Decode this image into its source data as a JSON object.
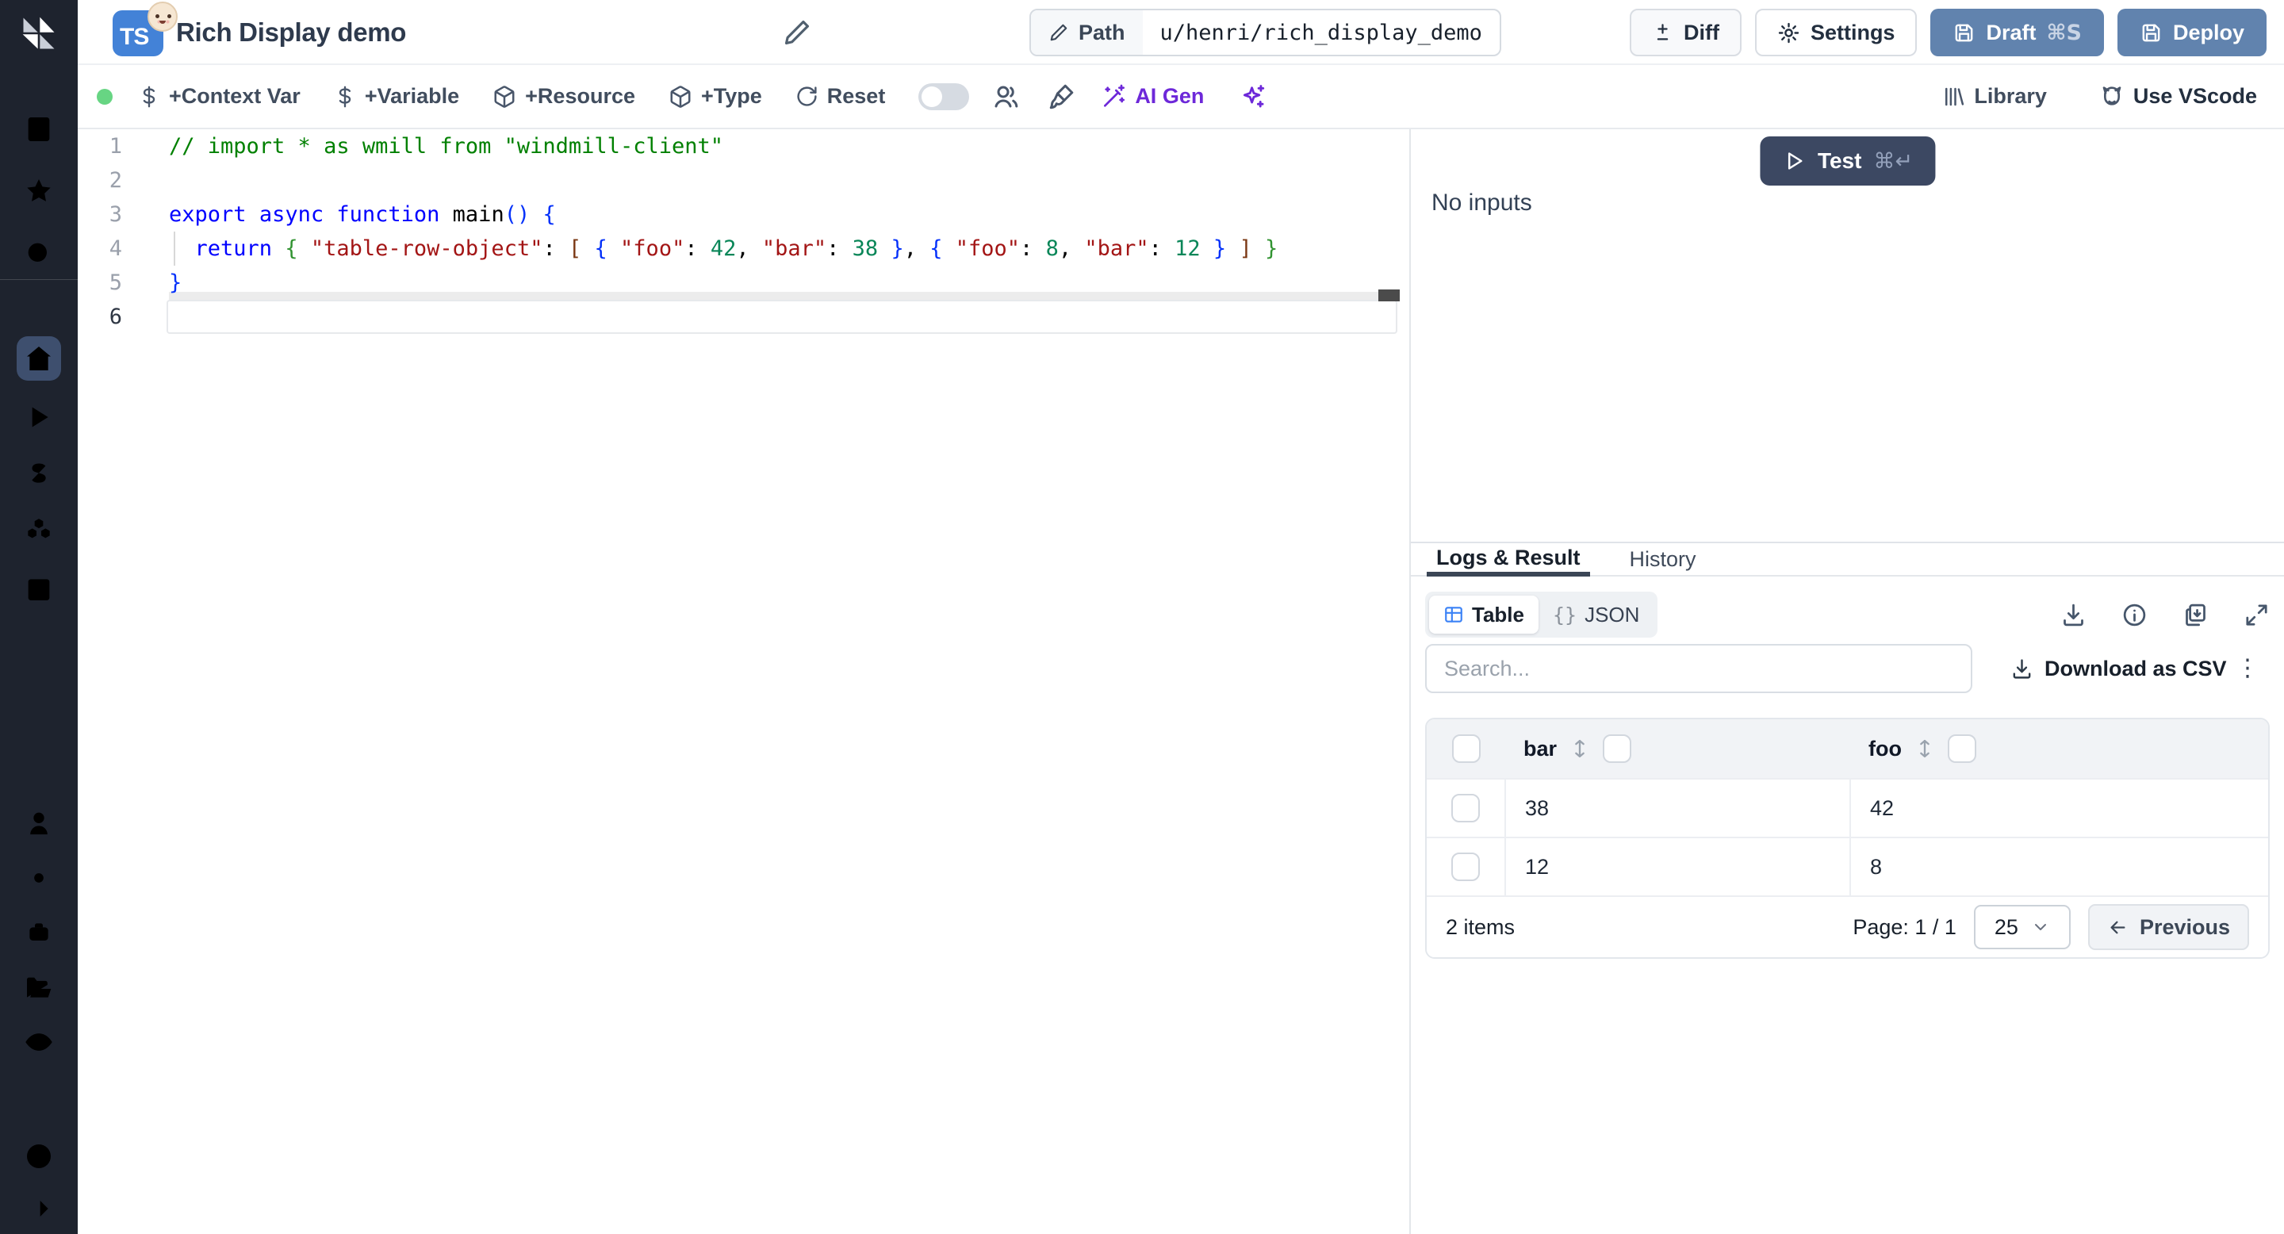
{
  "colors": {
    "sidebar_bg": "#1e232e",
    "sidebar_active": "#3e4f6e",
    "slate_button": "#6183ae",
    "test_button": "#3c4862",
    "accent_violet": "#6d28d9",
    "status_green": "#67d583",
    "ts_badge_blue": "#4382d7",
    "tab_underline": "#3b4656",
    "table_icon_blue": "#3b82f6",
    "syntax": {
      "comment": "#008000",
      "keyword": "#0000ff",
      "string": "#a31515",
      "number": "#098658",
      "bracket1": "#0431fa",
      "bracket2": "#319331",
      "bracket3": "#7b3814"
    }
  },
  "sidebar": {
    "logo": "windmill-logo",
    "top_items": [
      "buildings",
      "star",
      "search"
    ],
    "main_items": [
      "home",
      "runs-play",
      "variables-dollar",
      "resources-boxes",
      "schedules-calendar"
    ],
    "active_item": "home",
    "secondary_items": [
      "user",
      "settings-gear",
      "workers-bot",
      "folders",
      "audit-eye"
    ],
    "bottom_items": [
      "help",
      "expand-sidebar-arrow"
    ]
  },
  "header": {
    "lang_badge": "TS",
    "emoji_icon": "baby-face-emoji",
    "title": "Rich Display demo",
    "path_label": "Path",
    "path_value": "u/henri/rich_display_demo",
    "diff_label": "Diff",
    "settings_label": "Settings",
    "draft_label": "Draft",
    "draft_shortcut": "⌘S",
    "deploy_label": "Deploy"
  },
  "toolbar": {
    "context_var": "+Context Var",
    "variable": "+Variable",
    "resource": "+Resource",
    "type": "+Type",
    "reset": "Reset",
    "ai_gen": "AI Gen",
    "library": "Library",
    "vscode": "Use VScode"
  },
  "editor": {
    "language": "typescript",
    "active_line": 6,
    "lines": [
      {
        "tokens": [
          {
            "t": "// import * as wmill from \"windmill-client\"",
            "c": "comment"
          }
        ]
      },
      {
        "tokens": []
      },
      {
        "tokens": [
          {
            "t": "export",
            "c": "kw"
          },
          {
            "t": " ",
            "c": "pl"
          },
          {
            "t": "async",
            "c": "kw"
          },
          {
            "t": " ",
            "c": "pl"
          },
          {
            "t": "function",
            "c": "kw"
          },
          {
            "t": " ",
            "c": "pl"
          },
          {
            "t": "main",
            "c": "fn"
          },
          {
            "t": "(",
            "c": "b1"
          },
          {
            "t": ")",
            "c": "b1"
          },
          {
            "t": " ",
            "c": "pl"
          },
          {
            "t": "{",
            "c": "b1"
          }
        ]
      },
      {
        "tokens": [
          {
            "t": "  ",
            "c": "pl"
          },
          {
            "t": "return",
            "c": "kw"
          },
          {
            "t": " ",
            "c": "pl"
          },
          {
            "t": "{",
            "c": "b2"
          },
          {
            "t": " ",
            "c": "pl"
          },
          {
            "t": "\"table-row-object\"",
            "c": "str"
          },
          {
            "t": ": ",
            "c": "pl"
          },
          {
            "t": "[",
            "c": "b3"
          },
          {
            "t": " ",
            "c": "pl"
          },
          {
            "t": "{",
            "c": "b1"
          },
          {
            "t": " ",
            "c": "pl"
          },
          {
            "t": "\"foo\"",
            "c": "str"
          },
          {
            "t": ": ",
            "c": "pl"
          },
          {
            "t": "42",
            "c": "num"
          },
          {
            "t": ", ",
            "c": "pl"
          },
          {
            "t": "\"bar\"",
            "c": "str"
          },
          {
            "t": ": ",
            "c": "pl"
          },
          {
            "t": "38",
            "c": "num"
          },
          {
            "t": " ",
            "c": "pl"
          },
          {
            "t": "}",
            "c": "b1"
          },
          {
            "t": ", ",
            "c": "pl"
          },
          {
            "t": "{",
            "c": "b1"
          },
          {
            "t": " ",
            "c": "pl"
          },
          {
            "t": "\"foo\"",
            "c": "str"
          },
          {
            "t": ": ",
            "c": "pl"
          },
          {
            "t": "8",
            "c": "num"
          },
          {
            "t": ", ",
            "c": "pl"
          },
          {
            "t": "\"bar\"",
            "c": "str"
          },
          {
            "t": ": ",
            "c": "pl"
          },
          {
            "t": "12",
            "c": "num"
          },
          {
            "t": " ",
            "c": "pl"
          },
          {
            "t": "}",
            "c": "b1"
          },
          {
            "t": " ",
            "c": "pl"
          },
          {
            "t": "]",
            "c": "b3"
          },
          {
            "t": " ",
            "c": "pl"
          },
          {
            "t": "}",
            "c": "b2"
          }
        ]
      },
      {
        "tokens": [
          {
            "t": "}",
            "c": "b1"
          }
        ]
      },
      {
        "tokens": []
      }
    ]
  },
  "preview": {
    "test_label": "Test",
    "test_shortcut": "⌘↵",
    "no_inputs": "No inputs"
  },
  "result": {
    "tabs": [
      {
        "label": "Logs & Result",
        "active": true
      },
      {
        "label": "History",
        "active": false
      }
    ],
    "view_modes": [
      {
        "label": "Table",
        "active": true
      },
      {
        "label": "JSON",
        "active": false,
        "prefix": "{}"
      }
    ],
    "search_placeholder": "Search...",
    "download_csv_label": "Download as CSV",
    "table": {
      "columns": [
        "bar",
        "foo"
      ],
      "rows": [
        [
          "38",
          "42"
        ],
        [
          "12",
          "8"
        ]
      ],
      "items_count": "2 items",
      "page_label": "Page: 1 / 1",
      "page_size": "25",
      "previous_label": "Previous"
    }
  }
}
